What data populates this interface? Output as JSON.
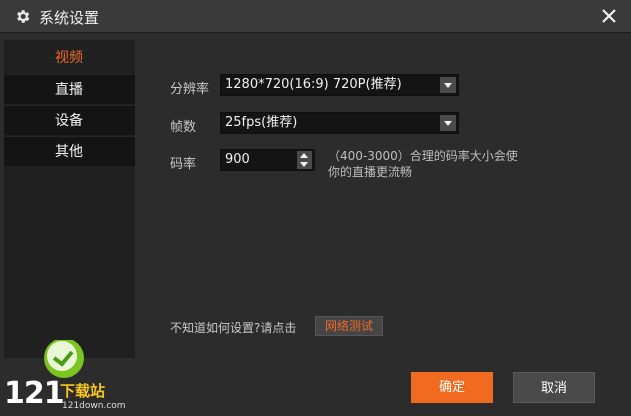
{
  "window": {
    "title": "系统设置",
    "icon": "gear-icon",
    "close_icon": "close-icon"
  },
  "sidebar": {
    "items": [
      {
        "label": "视频",
        "active": true
      },
      {
        "label": "直播",
        "active": false
      },
      {
        "label": "设备",
        "active": false
      },
      {
        "label": "其他",
        "active": false
      }
    ]
  },
  "video": {
    "resolution_label": "分辨率",
    "resolution_value": "1280*720(16:9) 720P(推荐)",
    "framerate_label": "帧数",
    "framerate_value": "25fps(推荐)",
    "bitrate_label": "码率",
    "bitrate_value": "900",
    "bitrate_hint_line1": "（400-3000）合理的码率大小会使",
    "bitrate_hint_line2": "你的直播更流畅"
  },
  "help": {
    "question": "不知道如何设置?请点击",
    "network_test_label": "网络测试"
  },
  "footer": {
    "ok_label": "确定",
    "cancel_label": "取消"
  },
  "watermark": {
    "number": "121",
    "text": "下载站",
    "url": "121down.com"
  },
  "colors": {
    "accent": "#f06a1f",
    "background": "#2c2c2c",
    "sidebar": "#141414"
  }
}
